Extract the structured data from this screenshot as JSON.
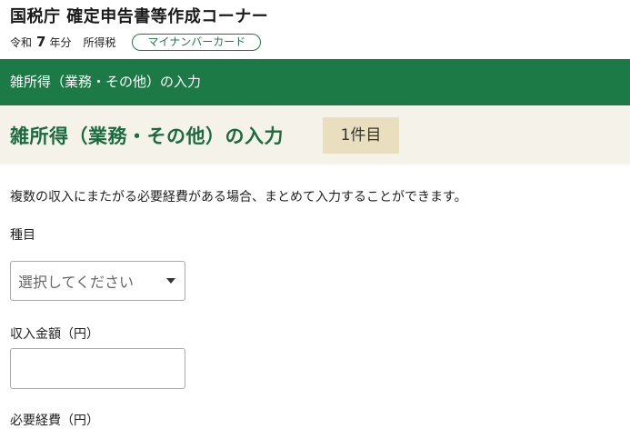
{
  "header": {
    "site_title": "国税庁 確定申告書等作成コーナー",
    "era": "令和",
    "year": "7",
    "year_suffix": "年分",
    "tax_type": "所得税",
    "mynumber_badge": "マイナンバーカード"
  },
  "section_bar": {
    "title": "雑所得（業務・その他）の入力"
  },
  "page": {
    "title": "雑所得（業務・その他）の入力",
    "count_badge": "1件目",
    "description": "複数の収入にまたがる必要経費がある場合、まとめて入力することができます。"
  },
  "form": {
    "category_label": "種目",
    "category_placeholder": "選択してください",
    "income_label": "収入金額（円）",
    "income_value": "",
    "expense_label": "必要経費（円）"
  }
}
